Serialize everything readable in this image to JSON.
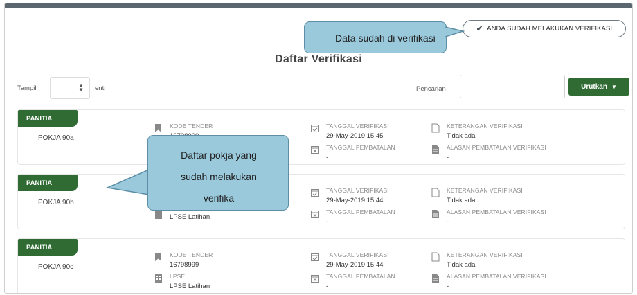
{
  "header": {
    "verify_badge": "ANDA SUDAH MELAKUKAN VERIFIKASI",
    "title": "Daftar Verifikasi"
  },
  "controls": {
    "show_label": "Tampil",
    "entries_label": "entri",
    "search_label": "Pencarian",
    "search_value": "",
    "sort_label": "Urutkan"
  },
  "labels": {
    "kode_tender": "KODE TENDER",
    "lpse": "LPSE",
    "tanggal_verifikasi": "TANGGAL VERIFIKASI",
    "tanggal_pembatalan": "TANGGAL PEMBATALAN",
    "keterangan": "KETERANGAN VERIFIKASI",
    "alasan": "ALASAN PEMBATALAN VERIFIKASI"
  },
  "cards": [
    {
      "role": "PANITIA",
      "pokja": "POKJA 90a",
      "kode": "16798999",
      "lpse": "",
      "tgl_verif": "29-May-2019 15:45",
      "tgl_batal": "-",
      "keterangan": "Tidak ada",
      "alasan": "-"
    },
    {
      "role": "PANITIA",
      "pokja": "POKJA 90b",
      "kode": "",
      "lpse": "LPSE Latihan",
      "tgl_verif": "29-May-2019 15:44",
      "tgl_batal": "-",
      "keterangan": "Tidak ada",
      "alasan": "-"
    },
    {
      "role": "PANITIA",
      "pokja": "POKJA 90c",
      "kode": "16798999",
      "lpse": "LPSE Latihan",
      "tgl_verif": "29-May-2019 15:44",
      "tgl_batal": "-",
      "keterangan": "Tidak ada",
      "alasan": "-"
    }
  ],
  "callouts": {
    "top": "Data sudah di verifikasi",
    "mid_line1": "Daftar pokja yang",
    "mid_line2": "sudah melakukan",
    "mid_line3": "verifika"
  }
}
